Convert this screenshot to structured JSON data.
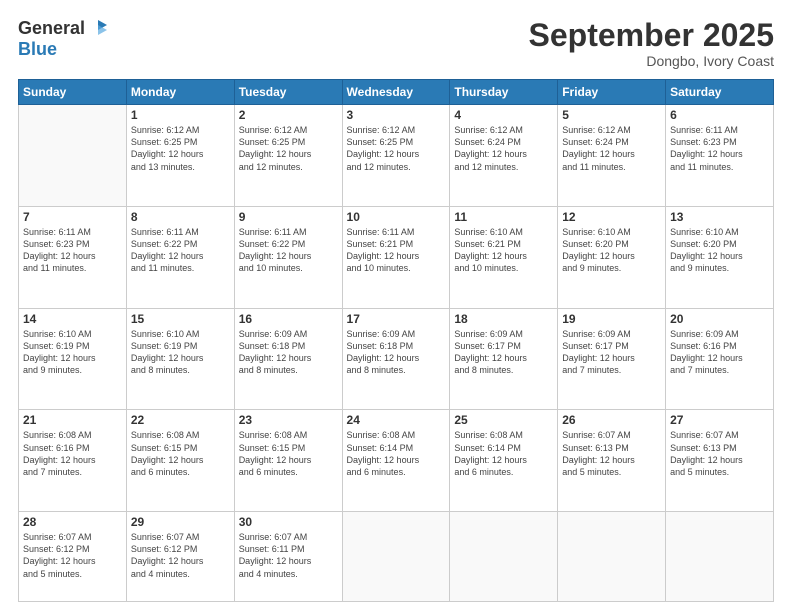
{
  "header": {
    "logo_general": "General",
    "logo_blue": "Blue",
    "month_title": "September 2025",
    "location": "Dongbo, Ivory Coast"
  },
  "days_of_week": [
    "Sunday",
    "Monday",
    "Tuesday",
    "Wednesday",
    "Thursday",
    "Friday",
    "Saturday"
  ],
  "weeks": [
    [
      {
        "day": "",
        "info": ""
      },
      {
        "day": "1",
        "info": "Sunrise: 6:12 AM\nSunset: 6:25 PM\nDaylight: 12 hours\nand 13 minutes."
      },
      {
        "day": "2",
        "info": "Sunrise: 6:12 AM\nSunset: 6:25 PM\nDaylight: 12 hours\nand 12 minutes."
      },
      {
        "day": "3",
        "info": "Sunrise: 6:12 AM\nSunset: 6:25 PM\nDaylight: 12 hours\nand 12 minutes."
      },
      {
        "day": "4",
        "info": "Sunrise: 6:12 AM\nSunset: 6:24 PM\nDaylight: 12 hours\nand 12 minutes."
      },
      {
        "day": "5",
        "info": "Sunrise: 6:12 AM\nSunset: 6:24 PM\nDaylight: 12 hours\nand 11 minutes."
      },
      {
        "day": "6",
        "info": "Sunrise: 6:11 AM\nSunset: 6:23 PM\nDaylight: 12 hours\nand 11 minutes."
      }
    ],
    [
      {
        "day": "7",
        "info": "Sunrise: 6:11 AM\nSunset: 6:23 PM\nDaylight: 12 hours\nand 11 minutes."
      },
      {
        "day": "8",
        "info": "Sunrise: 6:11 AM\nSunset: 6:22 PM\nDaylight: 12 hours\nand 11 minutes."
      },
      {
        "day": "9",
        "info": "Sunrise: 6:11 AM\nSunset: 6:22 PM\nDaylight: 12 hours\nand 10 minutes."
      },
      {
        "day": "10",
        "info": "Sunrise: 6:11 AM\nSunset: 6:21 PM\nDaylight: 12 hours\nand 10 minutes."
      },
      {
        "day": "11",
        "info": "Sunrise: 6:10 AM\nSunset: 6:21 PM\nDaylight: 12 hours\nand 10 minutes."
      },
      {
        "day": "12",
        "info": "Sunrise: 6:10 AM\nSunset: 6:20 PM\nDaylight: 12 hours\nand 9 minutes."
      },
      {
        "day": "13",
        "info": "Sunrise: 6:10 AM\nSunset: 6:20 PM\nDaylight: 12 hours\nand 9 minutes."
      }
    ],
    [
      {
        "day": "14",
        "info": "Sunrise: 6:10 AM\nSunset: 6:19 PM\nDaylight: 12 hours\nand 9 minutes."
      },
      {
        "day": "15",
        "info": "Sunrise: 6:10 AM\nSunset: 6:19 PM\nDaylight: 12 hours\nand 8 minutes."
      },
      {
        "day": "16",
        "info": "Sunrise: 6:09 AM\nSunset: 6:18 PM\nDaylight: 12 hours\nand 8 minutes."
      },
      {
        "day": "17",
        "info": "Sunrise: 6:09 AM\nSunset: 6:18 PM\nDaylight: 12 hours\nand 8 minutes."
      },
      {
        "day": "18",
        "info": "Sunrise: 6:09 AM\nSunset: 6:17 PM\nDaylight: 12 hours\nand 8 minutes."
      },
      {
        "day": "19",
        "info": "Sunrise: 6:09 AM\nSunset: 6:17 PM\nDaylight: 12 hours\nand 7 minutes."
      },
      {
        "day": "20",
        "info": "Sunrise: 6:09 AM\nSunset: 6:16 PM\nDaylight: 12 hours\nand 7 minutes."
      }
    ],
    [
      {
        "day": "21",
        "info": "Sunrise: 6:08 AM\nSunset: 6:16 PM\nDaylight: 12 hours\nand 7 minutes."
      },
      {
        "day": "22",
        "info": "Sunrise: 6:08 AM\nSunset: 6:15 PM\nDaylight: 12 hours\nand 6 minutes."
      },
      {
        "day": "23",
        "info": "Sunrise: 6:08 AM\nSunset: 6:15 PM\nDaylight: 12 hours\nand 6 minutes."
      },
      {
        "day": "24",
        "info": "Sunrise: 6:08 AM\nSunset: 6:14 PM\nDaylight: 12 hours\nand 6 minutes."
      },
      {
        "day": "25",
        "info": "Sunrise: 6:08 AM\nSunset: 6:14 PM\nDaylight: 12 hours\nand 6 minutes."
      },
      {
        "day": "26",
        "info": "Sunrise: 6:07 AM\nSunset: 6:13 PM\nDaylight: 12 hours\nand 5 minutes."
      },
      {
        "day": "27",
        "info": "Sunrise: 6:07 AM\nSunset: 6:13 PM\nDaylight: 12 hours\nand 5 minutes."
      }
    ],
    [
      {
        "day": "28",
        "info": "Sunrise: 6:07 AM\nSunset: 6:12 PM\nDaylight: 12 hours\nand 5 minutes."
      },
      {
        "day": "29",
        "info": "Sunrise: 6:07 AM\nSunset: 6:12 PM\nDaylight: 12 hours\nand 4 minutes."
      },
      {
        "day": "30",
        "info": "Sunrise: 6:07 AM\nSunset: 6:11 PM\nDaylight: 12 hours\nand 4 minutes."
      },
      {
        "day": "",
        "info": ""
      },
      {
        "day": "",
        "info": ""
      },
      {
        "day": "",
        "info": ""
      },
      {
        "day": "",
        "info": ""
      }
    ]
  ]
}
